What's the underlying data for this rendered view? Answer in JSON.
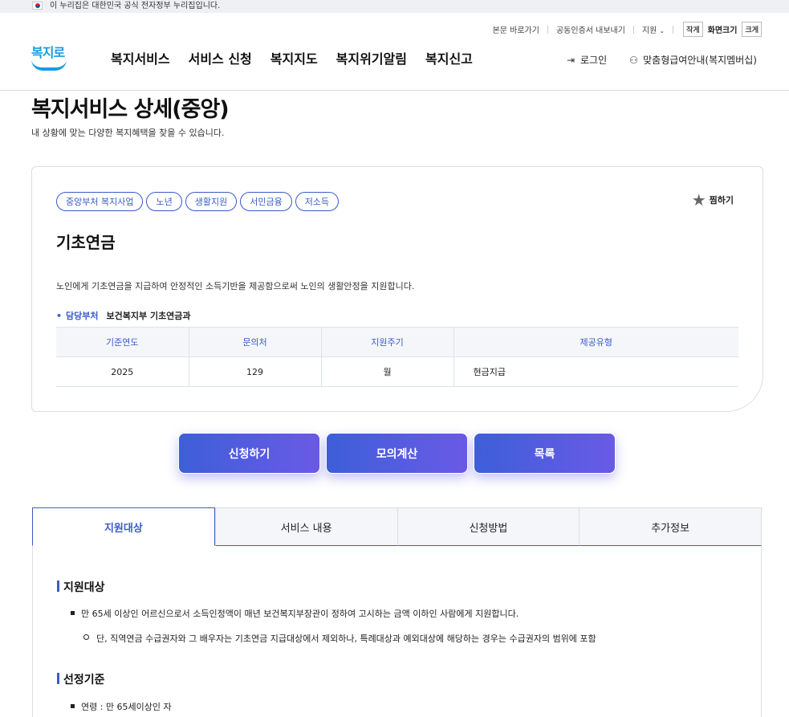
{
  "gov_banner": {
    "text": "이 누리집은 대한민국 공식 전자정부 누리집입니다."
  },
  "util_menu": {
    "skip": "본문 바로가기",
    "cert": "공동인증서 내보내기",
    "support": "지원",
    "small": "작게",
    "screen_size": "화면크기",
    "large": "크게"
  },
  "logo": {
    "text": "복지로"
  },
  "gnb": [
    "복지서비스",
    "서비스 신청",
    "복지지도",
    "복지위기알림",
    "복지신고"
  ],
  "header_right": {
    "login": "로그인",
    "membership": "맞춤형급여안내(복지멤버십)"
  },
  "page": {
    "title": "복지서비스 상세(중앙)",
    "subtitle": "내 상황에 맞는 다양한 복지혜택을 찾을 수 있습니다."
  },
  "service": {
    "tags": [
      "중앙부처 복지사업",
      "노년",
      "생활지원",
      "서민금융",
      "저소득"
    ],
    "favorite": "찜하기",
    "name": "기초연금",
    "description": "노인에게 기초연금을 지급하여 안정적인 소득기반을 제공함으로써 노인의 생활안정을 지원합니다.",
    "dept_label": "담당부처",
    "dept_value": "보건복지부 기초연금과",
    "table_headers": [
      "기준연도",
      "문의처",
      "지원주기",
      "제공유형"
    ],
    "table_values": [
      "2025",
      "129",
      "월",
      "현금지급"
    ]
  },
  "actions": {
    "apply": "신청하기",
    "simulate": "모의계산",
    "list": "목록"
  },
  "tabs": [
    "지원대상",
    "서비스 내용",
    "신청방법",
    "추가정보"
  ],
  "content": {
    "section1_title": "지원대상",
    "section1_bullet": "만 65세 이상인 어르신으로서 소득인정액이 매년 보건복지부장관이 정하여 고시하는 금액 이하인 사람에게 지원합니다.",
    "section1_sub": "단, 직역연금 수급권자와 그 배우자는 기초연금 지급대상에서 제외하나, 특례대상과 예외대상에 해당하는 경우는 수급권자의 범위에 포함",
    "section2_title": "선정기준",
    "section2_bullet": "연령 : 만 65세이상인 자"
  },
  "colors": {
    "accent": "#3a5bc7",
    "button_start": "#3d5fd8",
    "button_end": "#6a5ae6",
    "logo": "#1a9be0"
  }
}
